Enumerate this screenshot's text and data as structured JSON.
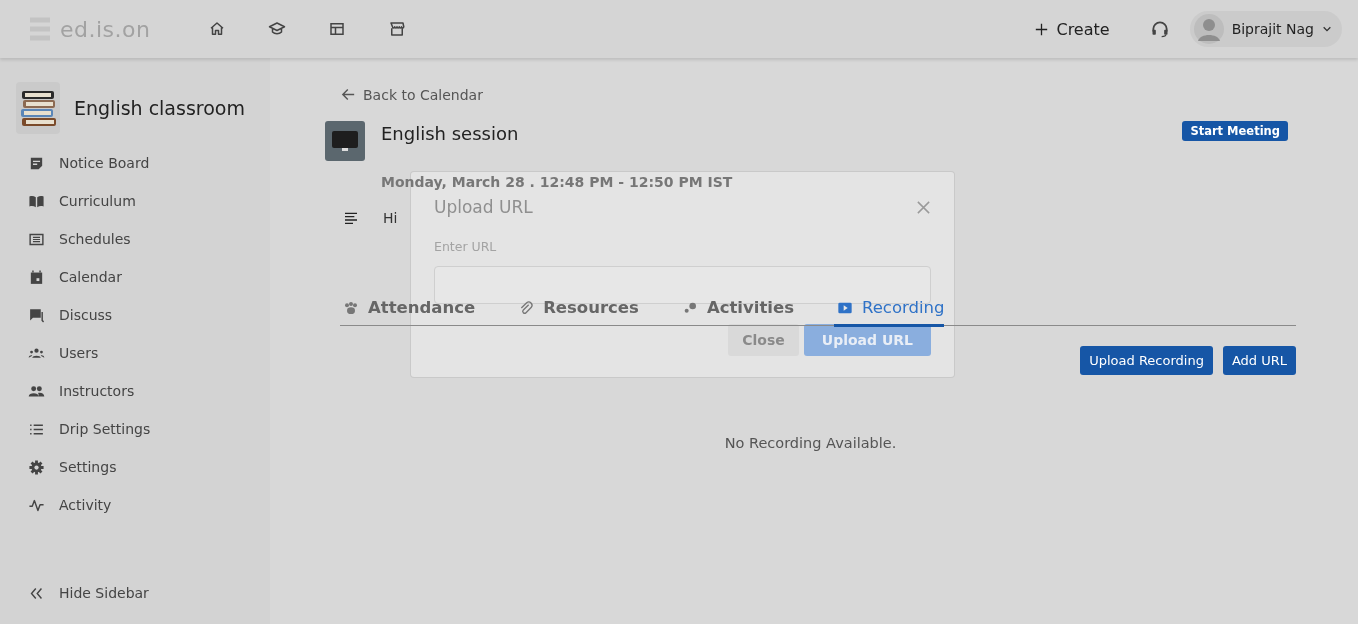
{
  "header": {
    "logo": "ed.is.on",
    "create_label": "Create",
    "user_name": "Biprajit Nag"
  },
  "sidebar": {
    "course_title": "English classroom",
    "items": [
      {
        "label": "Notice Board"
      },
      {
        "label": "Curriculum"
      },
      {
        "label": "Schedules"
      },
      {
        "label": "Calendar"
      },
      {
        "label": "Discuss"
      },
      {
        "label": "Users"
      },
      {
        "label": "Instructors"
      },
      {
        "label": "Drip Settings"
      },
      {
        "label": "Settings"
      },
      {
        "label": "Activity"
      }
    ],
    "hide_label": "Hide Sidebar"
  },
  "session": {
    "back_link": "Back to Calendar",
    "title": "English session",
    "start_button": "Start Meeting",
    "date": "Monday, March 28 . 12:48 PM - 12:50 PM IST",
    "description": "Hi",
    "tabs": [
      {
        "label": "Attendance",
        "selected": false
      },
      {
        "label": "Resources",
        "selected": false
      },
      {
        "label": "Activities",
        "selected": false
      },
      {
        "label": "Recording",
        "selected": true
      }
    ],
    "actions": [
      "Upload Recording",
      "Add URL"
    ],
    "empty_message": "No Recording Available."
  },
  "modal": {
    "title": "Upload URL",
    "field_label": "Enter URL",
    "close_button": "Close",
    "submit_button": "Upload URL"
  }
}
